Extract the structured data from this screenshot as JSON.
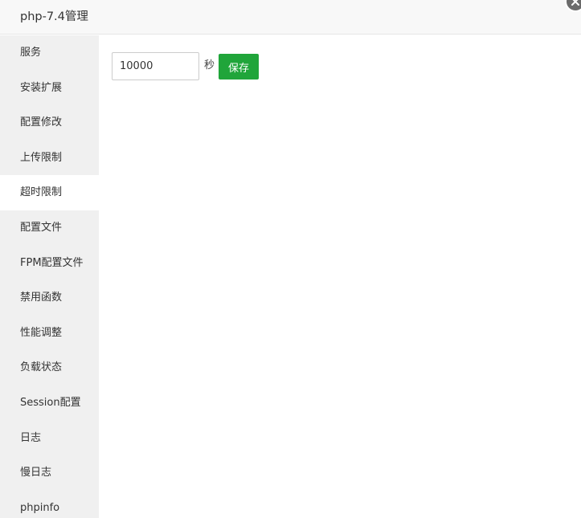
{
  "dialog": {
    "title": "php-7.4管理"
  },
  "sidebar": {
    "items": [
      {
        "label": "服务"
      },
      {
        "label": "安装扩展"
      },
      {
        "label": "配置修改"
      },
      {
        "label": "上传限制"
      },
      {
        "label": "超时限制",
        "active": true
      },
      {
        "label": "配置文件"
      },
      {
        "label": "FPM配置文件"
      },
      {
        "label": "禁用函数"
      },
      {
        "label": "性能调整"
      },
      {
        "label": "负载状态"
      },
      {
        "label": "Session配置"
      },
      {
        "label": "日志"
      },
      {
        "label": "慢日志"
      },
      {
        "label": "phpinfo"
      }
    ]
  },
  "timeout": {
    "value": "10000",
    "unit": "秒",
    "save_label": "保存"
  },
  "colors": {
    "accent": "#20a53a",
    "sidebar_bg": "#f0f0f0",
    "titlebar_bg": "#f8f8f8"
  }
}
